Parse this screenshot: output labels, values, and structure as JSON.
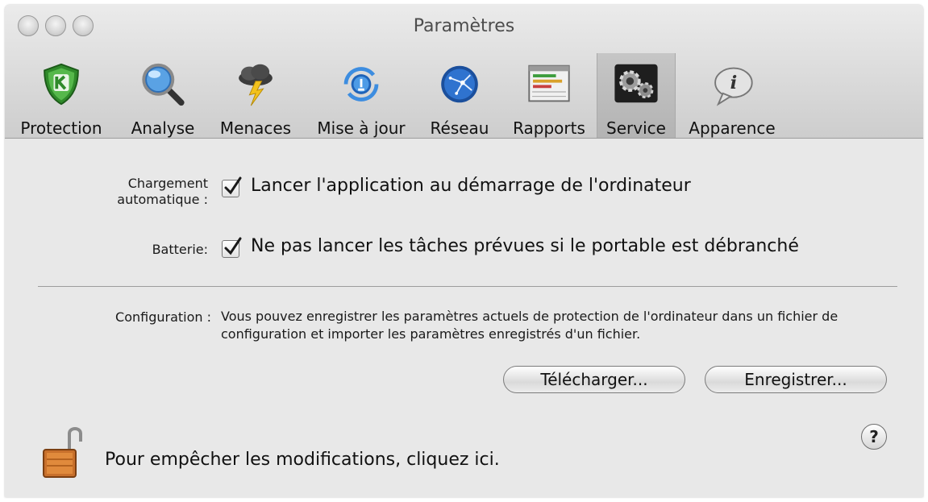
{
  "window": {
    "title": "Paramètres"
  },
  "toolbar": {
    "items": [
      {
        "label": "Protection",
        "icon": "shield-k-icon"
      },
      {
        "label": "Analyse",
        "icon": "magnifier-icon"
      },
      {
        "label": "Menaces",
        "icon": "storm-cloud-icon"
      },
      {
        "label": "Mise à jour",
        "icon": "update-globe-icon"
      },
      {
        "label": "Réseau",
        "icon": "network-globe-icon"
      },
      {
        "label": "Rapports",
        "icon": "report-table-icon"
      },
      {
        "label": "Service",
        "icon": "gears-icon",
        "selected": true
      },
      {
        "label": "Apparence",
        "icon": "speech-bubble-info-icon"
      }
    ]
  },
  "settings": {
    "autoload": {
      "label": "Chargement automatique :",
      "text": "Lancer l'application au démarrage de l'ordinateur",
      "checked": true
    },
    "battery": {
      "label": "Batterie:",
      "text": "Ne pas lancer les tâches prévues si le portable est débranché",
      "checked": true
    }
  },
  "configuration": {
    "label": "Configuration :",
    "description": "Vous pouvez enregistrer les paramètres actuels de protection de l'ordinateur dans un fichier de configuration et importer les paramètres enregistrés d'un fichier.",
    "load_button": "Télécharger...",
    "save_button": "Enregistrer..."
  },
  "footer": {
    "lock_text": "Pour empêcher les modifications, cliquez ici.",
    "help_label": "?"
  }
}
